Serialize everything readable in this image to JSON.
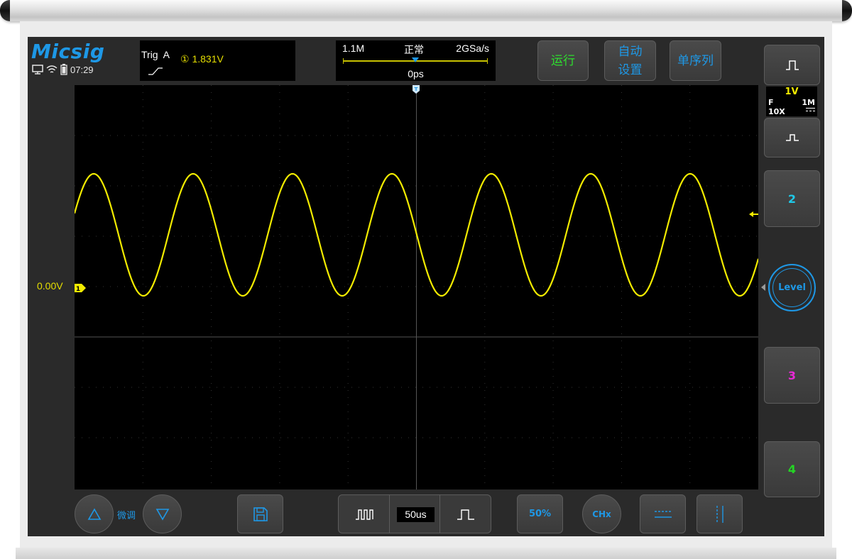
{
  "header": {
    "brand": "Micsig",
    "time": "07:29",
    "status_icons": [
      "monitor-icon",
      "wifi-icon",
      "battery-icon"
    ],
    "trigger": {
      "label": "Trig  A",
      "level": "① 1.831V",
      "edge": "rising-edge-icon"
    },
    "timebase": {
      "memory_depth": "1.1M",
      "mode": "正常",
      "sample_rate": "2GSa/s",
      "position": "0ps"
    },
    "buttons": {
      "run": "运行",
      "auto_line1": "自动",
      "auto_line2": "设置",
      "single": "单序列"
    }
  },
  "waveform": {
    "channel_1_offset": "0.00V",
    "ch1_marker": "1",
    "trigger_marker": "T",
    "trace_color": "#f2eb00",
    "grid_divisions": {
      "horizontal": 10,
      "vertical": 8
    }
  },
  "right_panel": {
    "ch1": {
      "volts_per_div": "1V",
      "coupling": "F",
      "impedance": "1M",
      "probe": "10X",
      "dc_icon": "dc-coupling-icon"
    },
    "ch2_label": "2",
    "ch3_label": "3",
    "ch4_label": "4",
    "level_label": "Level",
    "colors": {
      "ch1": "#f2eb00",
      "ch2": "#1fc9e8",
      "ch3": "#e82ad6",
      "ch4": "#24d624",
      "accent": "#1e98e6",
      "run": "#2ede2e"
    }
  },
  "toolbar": {
    "fine_label": "微调",
    "timebase_value": "50us",
    "fifty_percent": "50%",
    "chx": "CHx",
    "icons": [
      "up-triangle-icon",
      "down-triangle-icon",
      "save-icon",
      "wider-pulse-icon",
      "narrower-pulse-icon",
      "horizontal-cursor-icon",
      "vertical-cursor-icon"
    ]
  }
}
